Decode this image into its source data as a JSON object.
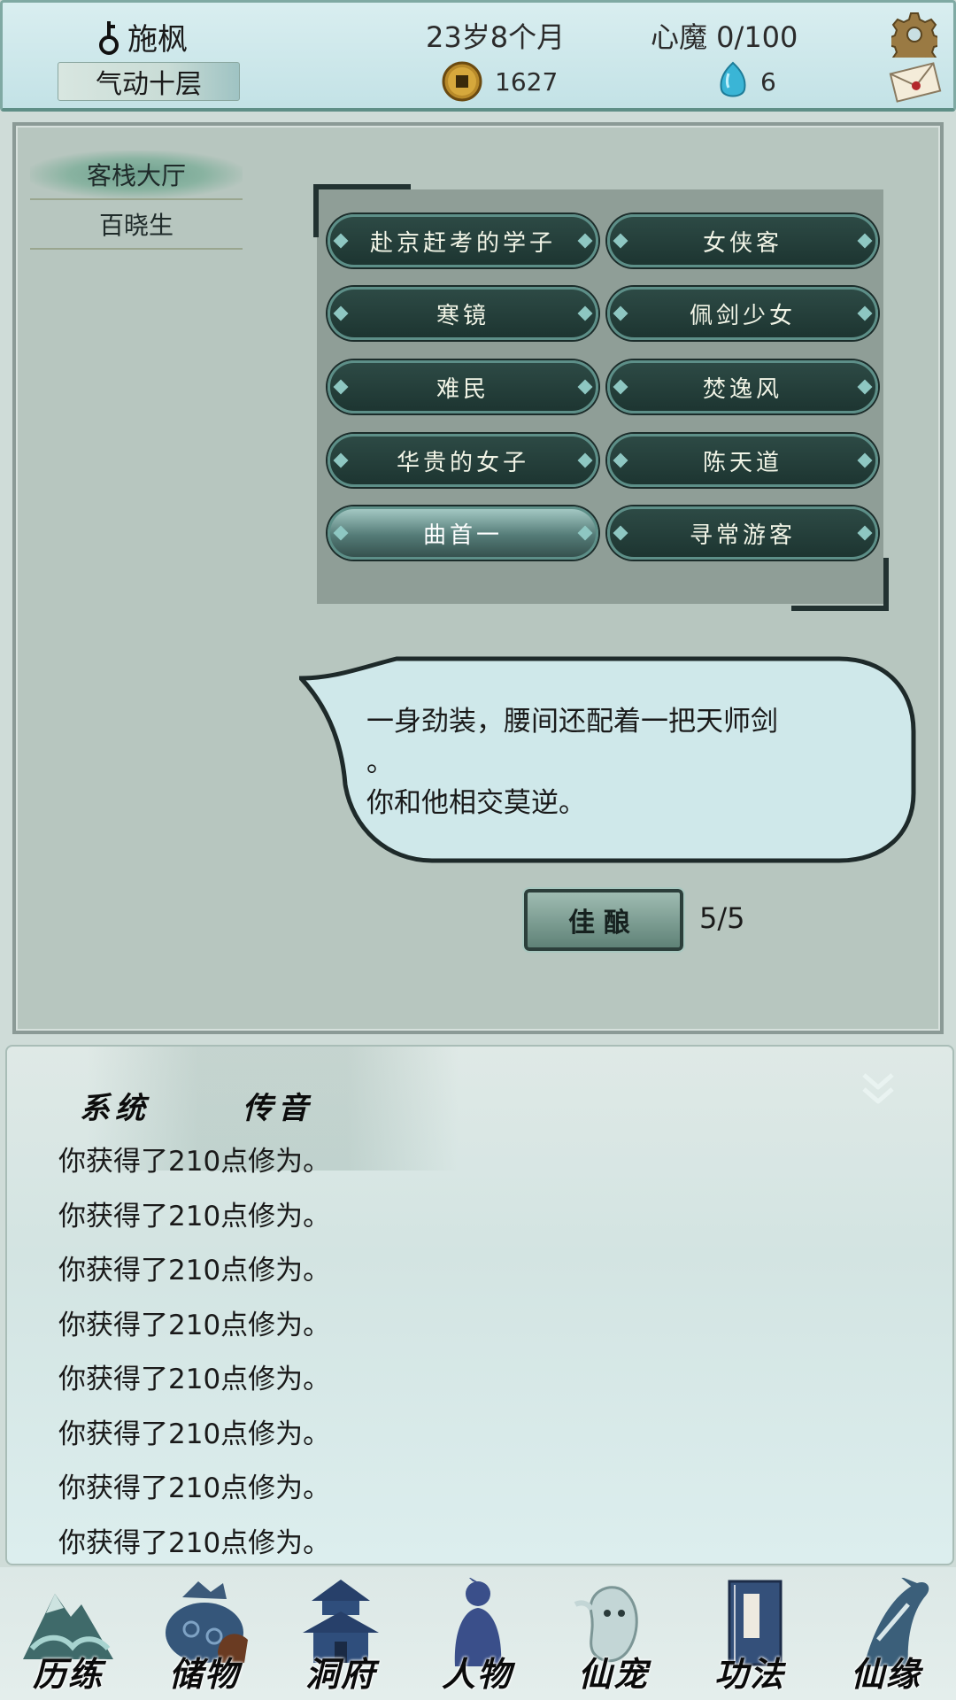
{
  "header": {
    "player_name": "施枫",
    "realm": "气动十层",
    "age": "23岁8个月",
    "heart_demon": "心魔  0/100",
    "coins": "1627",
    "spirit_stones": "6",
    "icons": {
      "gender": "male-symbol-icon",
      "coin": "copper-coin-icon",
      "stone": "spirit-stone-icon",
      "settings": "gear-icon",
      "mail": "mail-icon"
    }
  },
  "locations": [
    {
      "label": "客栈大厅",
      "active": true
    },
    {
      "label": "百晓生",
      "active": false
    }
  ],
  "npcs": [
    {
      "label": "赴京赶考的学子",
      "selected": false
    },
    {
      "label": "女侠客",
      "selected": false
    },
    {
      "label": "寒镜",
      "selected": false
    },
    {
      "label": "佩剑少女",
      "selected": false
    },
    {
      "label": "难民",
      "selected": false
    },
    {
      "label": "焚逸风",
      "selected": false
    },
    {
      "label": "华贵的女子",
      "selected": false
    },
    {
      "label": "陈天道",
      "selected": false
    },
    {
      "label": "曲首一",
      "selected": true
    },
    {
      "label": "寻常游客",
      "selected": false
    }
  ],
  "dialog": {
    "line1": "一身劲装，腰间还配着一把天师剑",
    "line2": "。",
    "line3": "你和他相交莫逆。"
  },
  "gift": {
    "button_label": "佳酿",
    "count": "5/5"
  },
  "log": {
    "tabs": [
      "系统",
      "传音"
    ],
    "lines": [
      "你获得了210点修为。",
      "你获得了210点修为。",
      "你获得了210点修为。",
      "你获得了210点修为。",
      "你获得了210点修为。",
      "你获得了210点修为。",
      "你获得了210点修为。",
      "你获得了210点修为。"
    ]
  },
  "nav": [
    {
      "label": "历练",
      "icon": "mountain-icon"
    },
    {
      "label": "储物",
      "icon": "storage-bag-icon"
    },
    {
      "label": "洞府",
      "icon": "pagoda-icon"
    },
    {
      "label": "人物",
      "icon": "character-silhouette-icon"
    },
    {
      "label": "仙宠",
      "icon": "spirit-pet-icon"
    },
    {
      "label": "功法",
      "icon": "scripture-book-icon"
    },
    {
      "label": "仙缘",
      "icon": "crane-icon"
    }
  ],
  "colors": {
    "npc_button_bg": "#1d3531",
    "npc_button_border": "#5d8f88",
    "panel_bg": "#b7c6bf",
    "header_bg": "#c3e2e6"
  }
}
